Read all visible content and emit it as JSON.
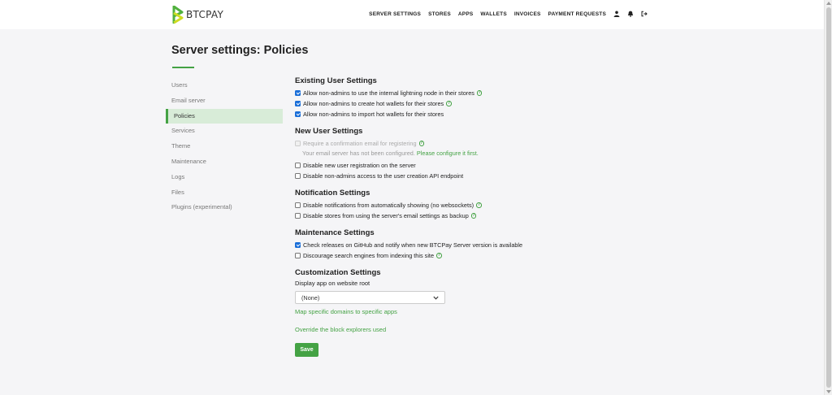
{
  "brand": {
    "name": "BTCPAY"
  },
  "nav": {
    "items": [
      "SERVER SETTINGS",
      "STORES",
      "APPS",
      "WALLETS",
      "INVOICES",
      "PAYMENT REQUESTS"
    ],
    "icons": [
      "user-icon",
      "bell-icon",
      "sign-out-icon"
    ]
  },
  "page": {
    "title": "Server settings: Policies"
  },
  "sidebar": {
    "items": [
      {
        "label": "Users",
        "active": false
      },
      {
        "label": "Email server",
        "active": false
      },
      {
        "label": "Policies",
        "active": true
      },
      {
        "label": "Services",
        "active": false
      },
      {
        "label": "Theme",
        "active": false
      },
      {
        "label": "Maintenance",
        "active": false
      },
      {
        "label": "Logs",
        "active": false
      },
      {
        "label": "Files",
        "active": false
      },
      {
        "label": "Plugins (experimental)",
        "active": false
      }
    ]
  },
  "sections": {
    "existing": {
      "title": "Existing User Settings",
      "items": [
        {
          "label": "Allow non-admins to use the internal lightning node in their stores",
          "checked": true
        },
        {
          "label": "Allow non-admins to create hot wallets for their stores",
          "checked": true
        },
        {
          "label": "Allow non-admins to import hot wallets for their stores",
          "checked": true
        }
      ]
    },
    "newuser": {
      "title": "New User Settings",
      "items": [
        {
          "label": "Require a confirmation email for registering",
          "checked": false,
          "disabled": true
        },
        {
          "label": "Disable new user registration on the server",
          "checked": false
        },
        {
          "label": "Disable non-admins access to the user creation API endpoint",
          "checked": false
        }
      ],
      "note": "Your email server has not been configured.",
      "note_link": "Please configure it first."
    },
    "notification": {
      "title": "Notification Settings",
      "items": [
        {
          "label": "Disable notifications from automatically showing (no websockets)",
          "checked": false
        },
        {
          "label": "Disable stores from using the server's email settings as backup",
          "checked": false
        }
      ]
    },
    "maintenance": {
      "title": "Maintenance Settings",
      "items": [
        {
          "label": "Check releases on GitHub and notify when new BTCPay Server version is available",
          "checked": true
        },
        {
          "label": "Discourage search engines from indexing this site",
          "checked": false
        }
      ]
    },
    "customization": {
      "title": "Customization Settings",
      "label": "Display app on website root",
      "select_value": "(None)",
      "map_link": "Map specific domains to specific apps",
      "block_link": "Override the block explorers used"
    }
  },
  "save_label": "Save",
  "colors": {
    "accent": "#44a244",
    "checkbox": "#1a6ed8"
  }
}
